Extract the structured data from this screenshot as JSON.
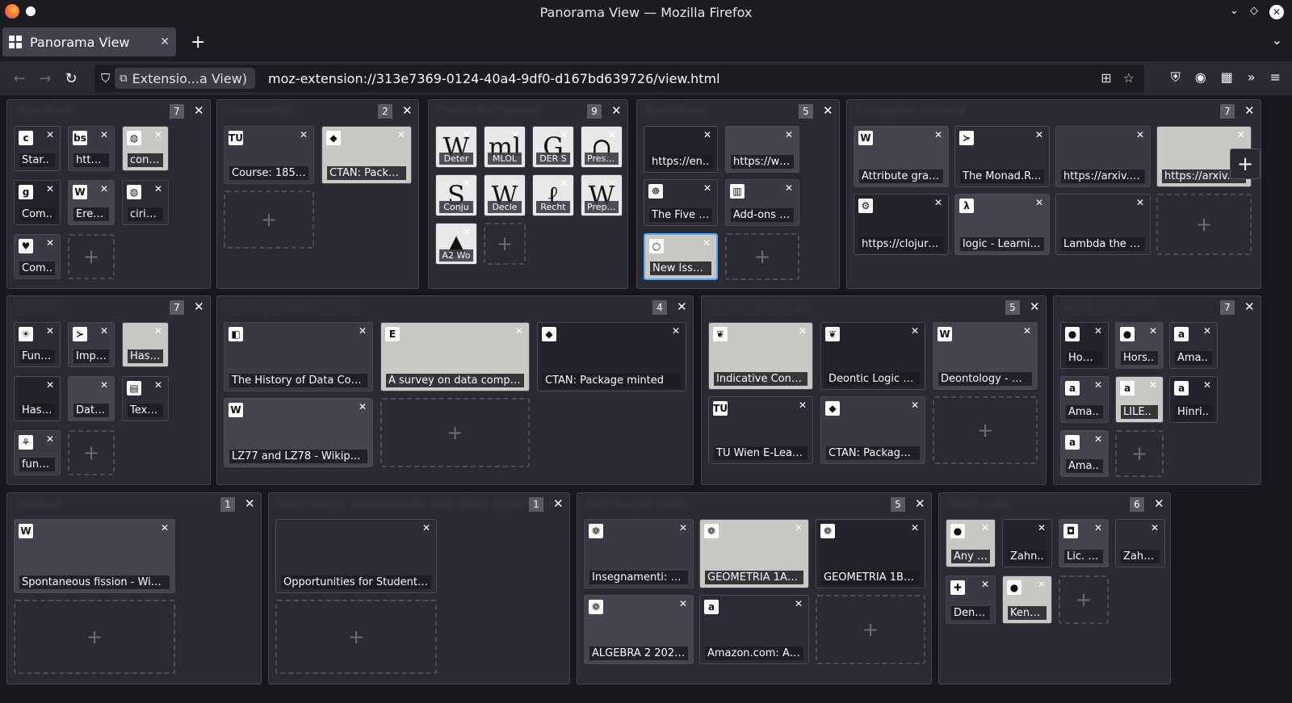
{
  "window": {
    "title": "Panorama View — Mozilla Firefox"
  },
  "tabs": [
    {
      "label": "Panorama View"
    }
  ],
  "identity": {
    "label": "Extensio...a View)"
  },
  "url": "moz-extension://313e7369-0124-40a4-9df0-d167bd639726/view.html",
  "groups": [
    {
      "title": "Standard",
      "count": "7",
      "cards": [
        "Star..",
        "https..",
        "contr..",
        "Com..",
        "Eredi..",
        "cirius..",
        "Com.."
      ]
    },
    {
      "title": "Universität",
      "count": "2",
      "cards": [
        "Course: 185.2..",
        "CTAN: Packag.."
      ]
    },
    {
      "title": "Deutsche Lernen",
      "count": "9",
      "cards": [
        "Deter",
        "MLOL",
        "DER S",
        "PressR",
        "Conju",
        "Decle",
        "Recht",
        "Prepos",
        "A2 Wo"
      ]
    },
    {
      "title": "Buddhism",
      "count": "5",
      "cards": [
        "https://en..",
        "https://ww..",
        "The Five M..",
        "Add-ons M..",
        "New Issue .."
      ]
    },
    {
      "title": "Computer Science",
      "count": "7",
      "cards": [
        "Attribute gram..",
        "The Monad.Rea..",
        "https://arxiv.or..",
        "https://arxiv.or..",
        "https://clojure...",
        "logic - Learnin..",
        "Lambda the Ul.."
      ]
    },
    {
      "title": "Haskell",
      "count": "7",
      "cards": [
        "Func..",
        "Impo..",
        "Hask..",
        "Hask..",
        "Data...",
        "Text...",
        "funct.."
      ]
    },
    {
      "title": "Undergraduate Thesis",
      "count": "4",
      "cards": [
        "The History of Data Compr...",
        "A survey on data compres...",
        "CTAN: Package minted",
        "LZ77 and LZ78 - Wikipedia"
      ]
    },
    {
      "title": "Unnamed Group",
      "count": "5",
      "cards": [
        "Indicative Conditi..",
        "Deontic Logic (St..",
        "Deontology - Wiki..",
        "TU Wien E-Learni..",
        "CTAN: Package va.."
      ]
    },
    {
      "title": "Jump rope mat",
      "count": "7",
      "cards": [
        "How ..",
        "Hors..",
        "Ama..",
        "Ama..",
        "LILE..",
        "Hinri..",
        "Ama.."
      ]
    },
    {
      "title": "Science",
      "count": "1",
      "cards": [
        "Spontaneous fission - Wikipe.."
      ]
    },
    {
      "title": "Internships, conferences and other opportunit...",
      "count": "1",
      "cards": [
        "Opportunities for Students | .."
      ]
    },
    {
      "title": "Self-taught math",
      "count": "5",
      "cards": [
        "Insegnamenti: pia..",
        "GEOMETRIA 1A 2..",
        "GEOMETRIA 1B 2..",
        "ALGEBRA 2 2021/..",
        "Amazon.com: Alg.."
      ]
    },
    {
      "title": "Teeth care",
      "count": "6",
      "cards": [
        "Any d..",
        "Zahn..",
        "Lic. G..",
        "Zahni..",
        "Denti..",
        "Kennt.."
      ]
    }
  ]
}
